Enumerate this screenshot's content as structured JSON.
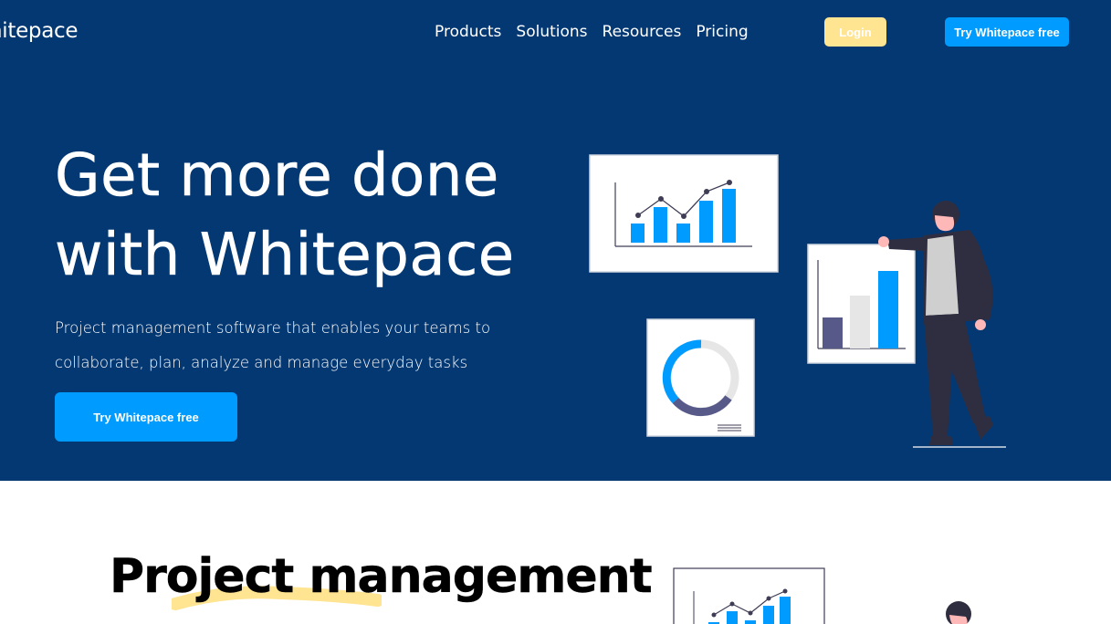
{
  "header": {
    "logo_text": "nitepace",
    "nav": [
      "Products",
      "Solutions",
      "Resources",
      "Pricing"
    ],
    "login_label": "Login",
    "try_label": "Try Whitepace free"
  },
  "hero": {
    "title_line1": "Get more done",
    "title_line2": "with Whitepace",
    "subtitle": "Project management software that enables your teams to collaborate, plan, analyze and manage everyday tasks",
    "cta_label": "Try Whitepace free"
  },
  "section": {
    "title": "Project management"
  },
  "colors": {
    "hero_bg": "#043873",
    "accent_blue": "#009bff",
    "login_yellow": "#ffe492",
    "highlight_yellow": "#ffe492"
  }
}
